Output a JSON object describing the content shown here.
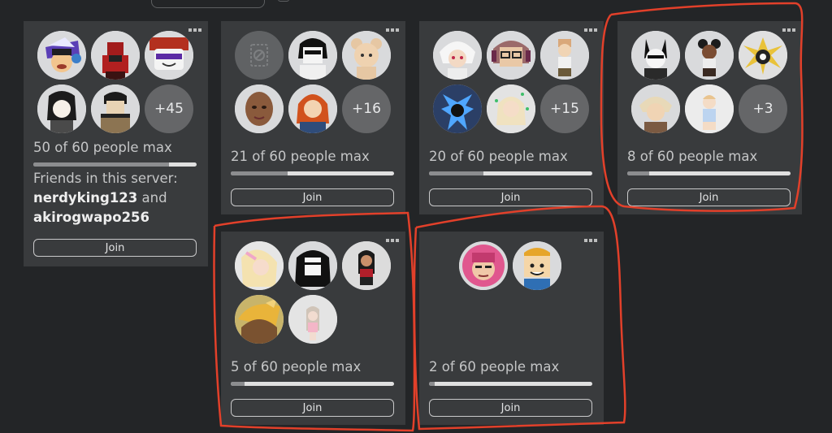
{
  "more_menu_icon": "ellipsis-icon",
  "annotation_color": "#e2402a",
  "servers": [
    {
      "capacity_text": "50 of 60 people max",
      "fill_fraction": 0.833,
      "more_count": "+45",
      "friends_label": "Friends in this server:",
      "friend_1": "nerdyking123",
      "friends_and": "and",
      "friend_2": "akirogwapo256",
      "join_label": "Join"
    },
    {
      "capacity_text": "21 of 60 people max",
      "fill_fraction": 0.35,
      "more_count": "+16",
      "join_label": "Join"
    },
    {
      "capacity_text": "20 of 60 people max",
      "fill_fraction": 0.333,
      "more_count": "+15",
      "join_label": "Join"
    },
    {
      "capacity_text": "8 of 60 people max",
      "fill_fraction": 0.133,
      "more_count": "+3",
      "join_label": "Join"
    },
    {
      "capacity_text": "5 of 60 people max",
      "fill_fraction": 0.083,
      "join_label": "Join"
    },
    {
      "capacity_text": "2 of 60 people max",
      "fill_fraction": 0.033,
      "join_label": "Join"
    }
  ]
}
